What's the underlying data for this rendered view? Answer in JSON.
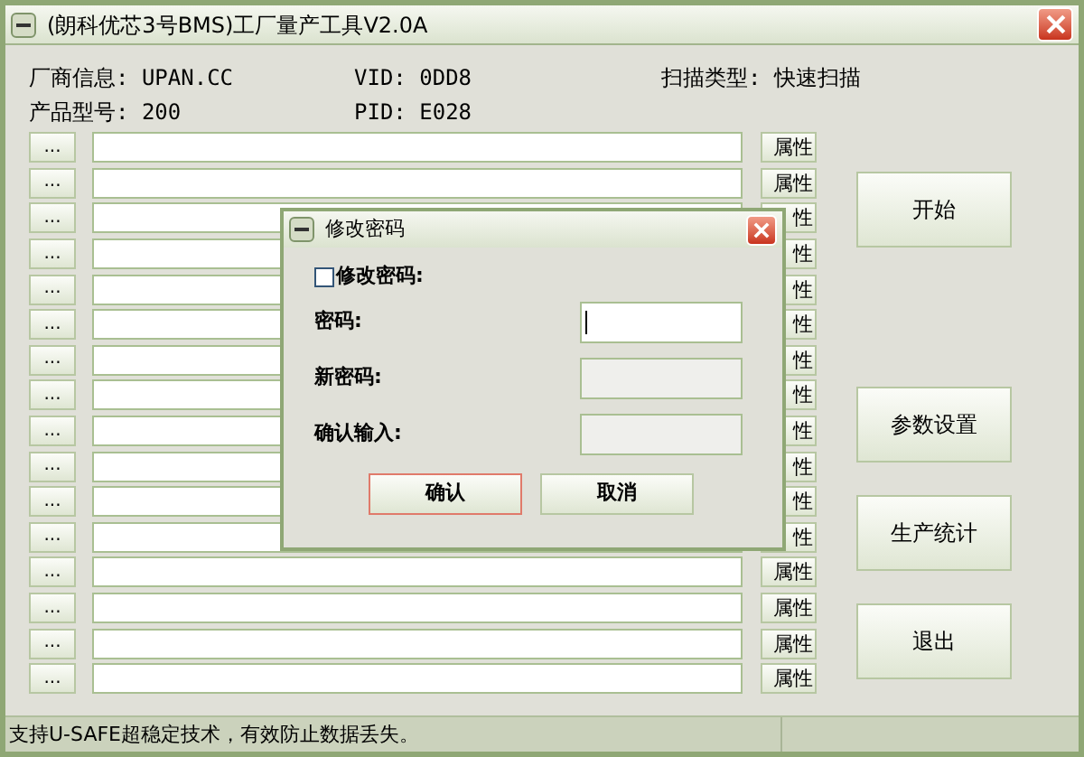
{
  "window": {
    "title": "(朗科优芯3号BMS)工厂量产工具V2.0A"
  },
  "info": {
    "vendor": "厂商信息: UPAN.CC",
    "model": "产品型号: 200",
    "vid": "VID: 0DD8",
    "pid": "PID: E028",
    "scan_type": "扫描类型: 快速扫描"
  },
  "rows": [
    {
      "button": "...",
      "property": "属性"
    },
    {
      "button": "...",
      "property": "属性"
    },
    {
      "button": "...",
      "property": "性"
    },
    {
      "button": "...",
      "property": "性"
    },
    {
      "button": "...",
      "property": "性"
    },
    {
      "button": "...",
      "property": "性"
    },
    {
      "button": "...",
      "property": "性"
    },
    {
      "button": "...",
      "property": "性"
    },
    {
      "button": "...",
      "property": "性"
    },
    {
      "button": "...",
      "property": "性"
    },
    {
      "button": "...",
      "property": "性"
    },
    {
      "button": "...",
      "property": "性"
    },
    {
      "button": "...",
      "property": "属性"
    },
    {
      "button": "...",
      "property": "属性"
    },
    {
      "button": "...",
      "property": "属性"
    },
    {
      "button": "...",
      "property": "属性"
    }
  ],
  "side_buttons": [
    "开始",
    "参数设置",
    "生产统计",
    "退出"
  ],
  "status_bar": "支持U-SAFE超稳定技术，有效防止数据丢失。",
  "dialog": {
    "title": "修改密码",
    "checkbox": {
      "label": "修改密码:",
      "checked": false
    },
    "fields": [
      {
        "label": "密码:",
        "disabled": false
      },
      {
        "label": "新密码:",
        "disabled": true
      },
      {
        "label": "确认输入:",
        "disabled": true
      }
    ],
    "buttons": [
      {
        "label": "确认",
        "selected": true
      },
      {
        "label": "取消",
        "selected": false
      }
    ]
  }
}
